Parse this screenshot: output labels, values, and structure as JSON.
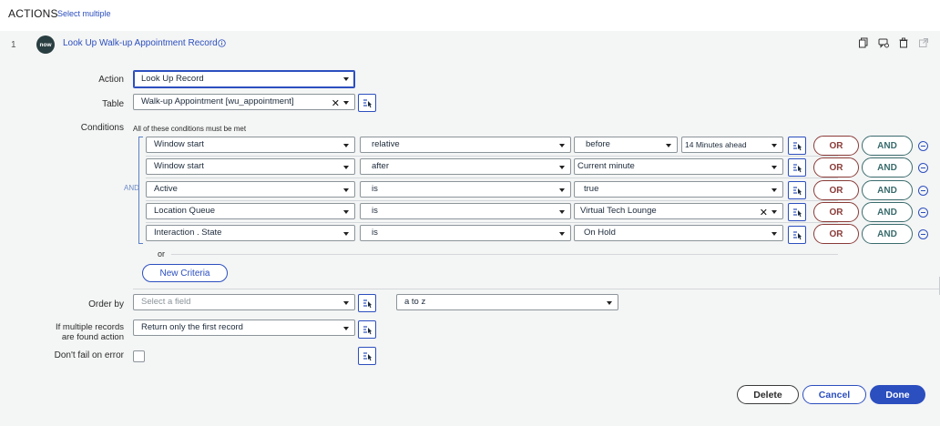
{
  "header": {
    "title": "ACTIONS",
    "select_multiple": "Select multiple"
  },
  "step": {
    "number": "1",
    "logo_text": "now",
    "title": "Look Up Walk-up Appointment Record",
    "icons": [
      "copy-icon",
      "comment-icon",
      "delete-icon",
      "open-external-icon"
    ]
  },
  "form": {
    "action_label": "Action",
    "action_value": "Look Up Record",
    "table_label": "Table",
    "table_value": "Walk-up Appointment [wu_appointment]",
    "conditions_label": "Conditions",
    "conditions_note": "All of these conditions must be met",
    "and_label": "AND",
    "or_label": "or",
    "conditions": [
      {
        "field": "Window start",
        "operator": "relative",
        "value": "before",
        "extra": "14 Minutes ahead"
      },
      {
        "field": "Window start",
        "operator": "after",
        "value": "Current minute",
        "extra": ""
      },
      {
        "field": "Active",
        "operator": "is",
        "value": "true",
        "extra": ""
      },
      {
        "field": "Location Queue",
        "operator": "is",
        "value": "Virtual Tech Lounge",
        "extra": ""
      },
      {
        "field": "Interaction . State",
        "operator": "is",
        "value": "On Hold",
        "extra": ""
      }
    ],
    "or_button": "OR",
    "and_button": "AND",
    "new_criteria": "New Criteria",
    "order_by_label": "Order by",
    "order_by_placeholder": "Select a field",
    "order_direction": "a to z",
    "multiple_label_1": "If multiple records",
    "multiple_label_2": "are found action",
    "multiple_value": "Return only the first record",
    "dont_fail_label": "Don't fail on error",
    "dont_fail_checked": false
  },
  "buttons": {
    "delete": "Delete",
    "cancel": "Cancel",
    "done": "Done"
  },
  "colors": {
    "accent": "#2c4fbf",
    "or": "#8a3b38",
    "and": "#3a6b6c",
    "logo_bg": "#293e40"
  }
}
